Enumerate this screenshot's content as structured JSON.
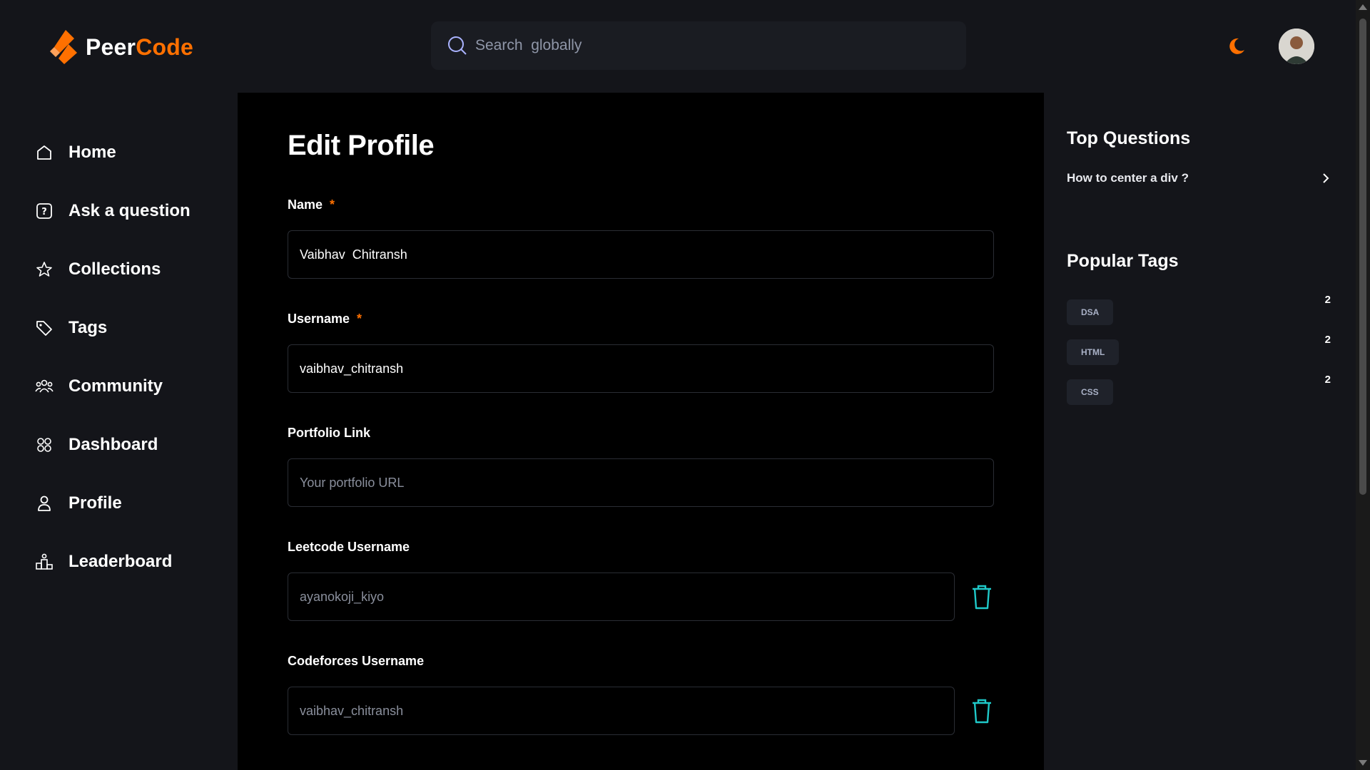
{
  "brand": {
    "name_part1": "Peer",
    "name_part2": "Code",
    "accent": "#ff7000"
  },
  "search": {
    "placeholder": "Search  globally"
  },
  "sidebar": {
    "items": [
      {
        "label": "Home",
        "icon": "home-icon"
      },
      {
        "label": "Ask a question",
        "icon": "question-icon"
      },
      {
        "label": "Collections",
        "icon": "star-icon"
      },
      {
        "label": "Tags",
        "icon": "tag-icon"
      },
      {
        "label": "Community",
        "icon": "users-icon"
      },
      {
        "label": "Dashboard",
        "icon": "grid-icon"
      },
      {
        "label": "Profile",
        "icon": "user-icon"
      },
      {
        "label": "Leaderboard",
        "icon": "podium-icon"
      }
    ]
  },
  "main": {
    "title": "Edit Profile",
    "fields": {
      "name": {
        "label": "Name",
        "required_mark": "*",
        "value": "Vaibhav  Chitransh"
      },
      "username": {
        "label": "Username",
        "required_mark": "*",
        "value": "vaibhav_chitransh"
      },
      "portfolio": {
        "label": "Portfolio Link",
        "placeholder": "Your portfolio URL"
      },
      "leetcode": {
        "label": "Leetcode Username",
        "value": "ayanokoji_kiyo"
      },
      "codeforces": {
        "label": "Codeforces Username",
        "value": "vaibhav_chitransh"
      }
    },
    "trash_color": "#1fc8c8"
  },
  "right": {
    "top_questions_title": "Top Questions",
    "top_questions": [
      {
        "text": "How to center a div ?"
      }
    ],
    "popular_tags_title": "Popular Tags",
    "tags": [
      {
        "name": "DSA",
        "count": "2"
      },
      {
        "name": "HTML",
        "count": "2"
      },
      {
        "name": "CSS",
        "count": "2"
      }
    ]
  }
}
